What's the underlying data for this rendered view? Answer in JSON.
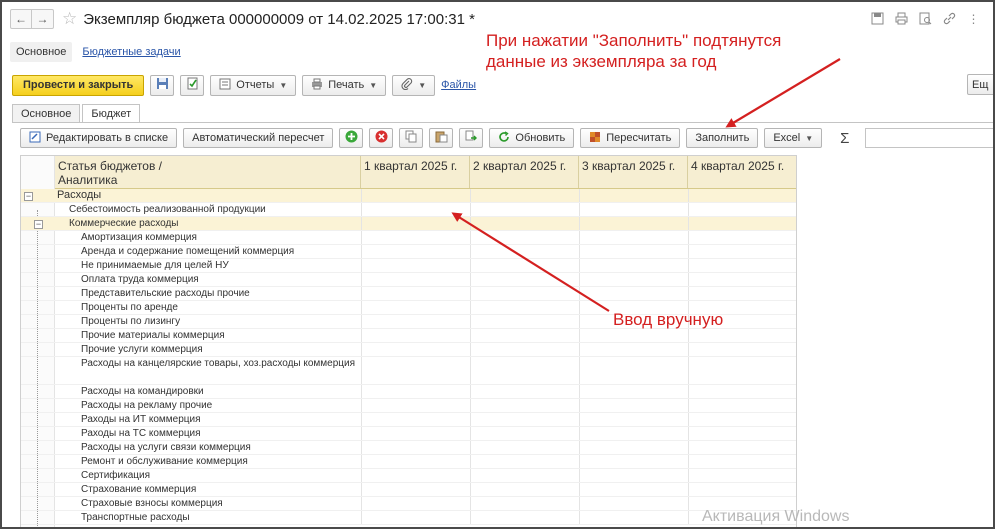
{
  "window": {
    "title": "Экземпляр бюджета 000000009 от 14.02.2025 17:00:31 *"
  },
  "sections": {
    "main": "Основное",
    "tasks": "Бюджетные задачи"
  },
  "toolbar": {
    "post_close": "Провести и закрыть",
    "reports": "Отчеты",
    "print": "Печать",
    "files": "Файлы",
    "far_right": "Ещ"
  },
  "tabs": [
    "Основное",
    "Бюджет"
  ],
  "budget_toolbar": {
    "edit_list": "Редактировать в списке",
    "auto_recalc": "Автоматический пересчет",
    "refresh": "Обновить",
    "recalc": "Пересчитать",
    "fill": "Заполнить",
    "excel": "Excel",
    "sigma": "Σ"
  },
  "table": {
    "header_line1": "Статья бюджетов /",
    "header_line2": "Аналитика",
    "columns": [
      "1 квартал 2025 г.",
      "2 квартал 2025 г.",
      "3 квартал 2025 г.",
      "4 квартал 2025 г."
    ],
    "rows": [
      {
        "label": "Расходы",
        "level": 0,
        "highlight": true,
        "expander": "−"
      },
      {
        "label": "Себестоимость реализованной продукции",
        "level": 1,
        "highlight": false
      },
      {
        "label": "Коммерческие расходы",
        "level": 1,
        "highlight": true,
        "expander": "−"
      },
      {
        "label": "Амортизация коммерция",
        "level": 2
      },
      {
        "label": "Аренда и содержание помещений коммерция",
        "level": 2
      },
      {
        "label": "Не принимаемые для целей НУ",
        "level": 2
      },
      {
        "label": "Оплата труда коммерция",
        "level": 2
      },
      {
        "label": "Представительские расходы прочие",
        "level": 2
      },
      {
        "label": "Проценты по аренде",
        "level": 2
      },
      {
        "label": "Проценты по лизингу",
        "level": 2
      },
      {
        "label": "Прочие материалы коммерция",
        "level": 2
      },
      {
        "label": "Прочие услуги коммерция",
        "level": 2
      },
      {
        "label": "Расходы на канцелярские товары, хоз.расходы коммерция",
        "level": 2,
        "tall": true
      },
      {
        "label": "Расходы на командировки",
        "level": 2
      },
      {
        "label": "Расходы на рекламу прочие",
        "level": 2
      },
      {
        "label": "Раходы на ИТ коммерция",
        "level": 2
      },
      {
        "label": "Раходы на ТС коммерция",
        "level": 2
      },
      {
        "label": "Расходы на услуги связи коммерция",
        "level": 2
      },
      {
        "label": "Ремонт и обслуживание коммерция",
        "level": 2
      },
      {
        "label": "Сертификация",
        "level": 2
      },
      {
        "label": "Страхование коммерция",
        "level": 2
      },
      {
        "label": "Страховые взносы коммерция",
        "level": 2
      },
      {
        "label": "Транспортные расходы",
        "level": 2
      }
    ]
  },
  "annotations": {
    "fill_note": "При нажатии \"Заполнить\" подтянутся данные из экземпляра за год",
    "manual_note": "Ввод вручную"
  },
  "watermark": "Активация Windows",
  "colors": {
    "annotation": "#d42020",
    "primary_button": "#f5cf1d",
    "header_bg": "#f6eed2",
    "row_highlight": "#fbf3d6"
  }
}
